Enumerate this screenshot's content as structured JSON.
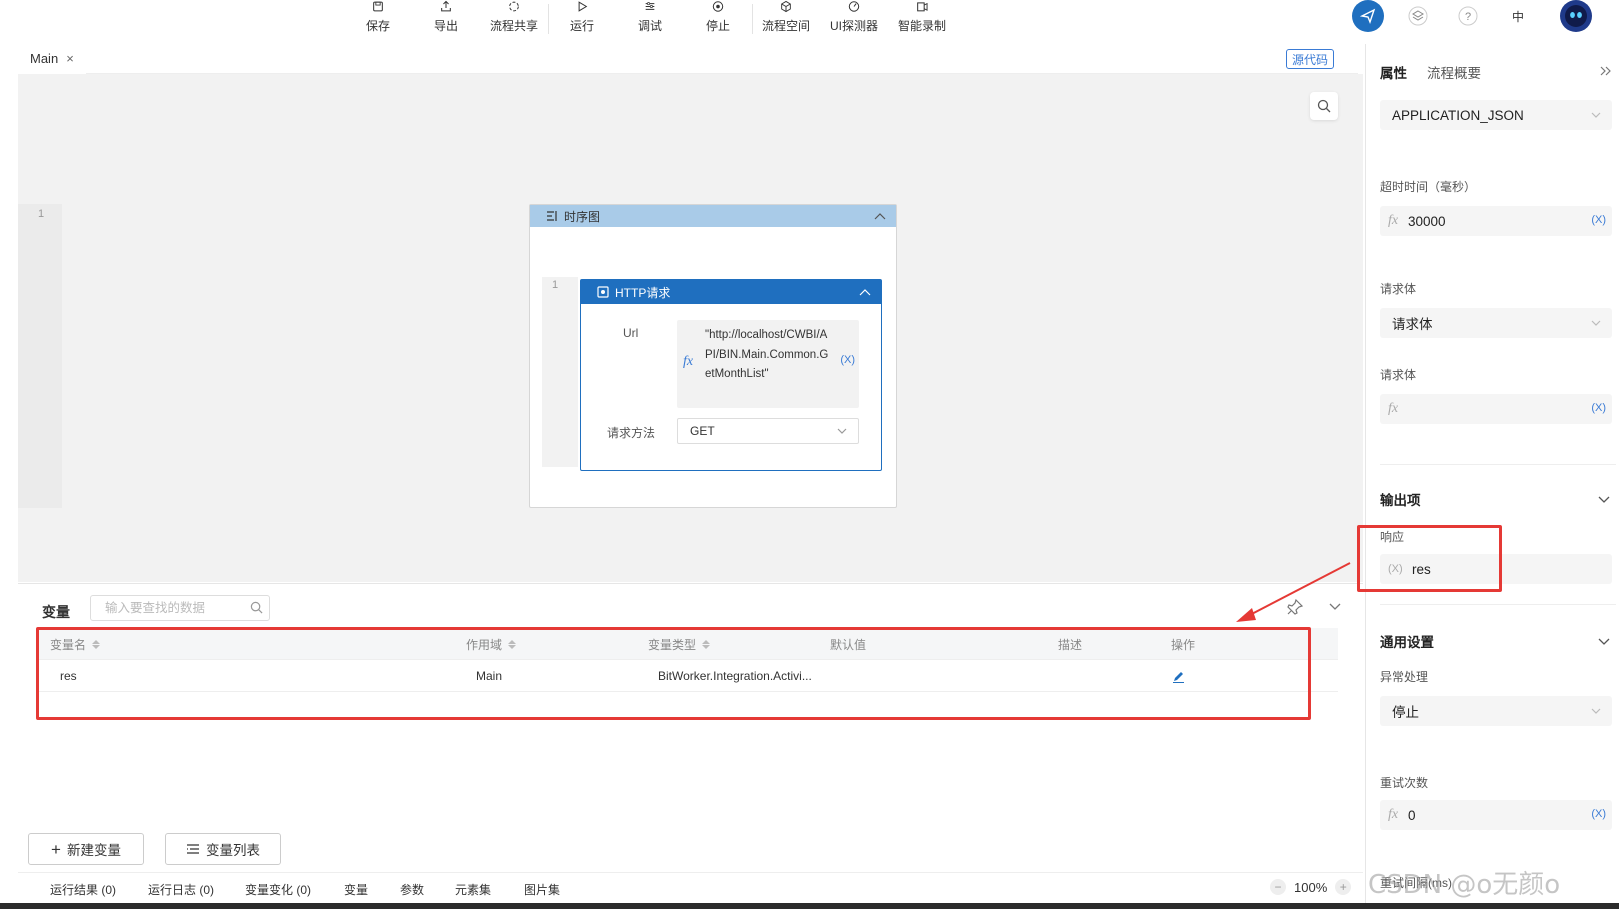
{
  "toolbar": {
    "items": [
      {
        "label": "保存",
        "icon": "save-icon"
      },
      {
        "label": "导出",
        "icon": "export-icon"
      },
      {
        "label": "流程共享",
        "icon": "share-icon"
      },
      {
        "label": "运行",
        "icon": "play-icon"
      },
      {
        "label": "调试",
        "icon": "debug-icon"
      },
      {
        "label": "停止",
        "icon": "stop-icon"
      },
      {
        "label": "流程空间",
        "icon": "cube-icon"
      },
      {
        "label": "UI探测器",
        "icon": "detector-icon"
      },
      {
        "label": "智能录制",
        "icon": "record-icon"
      }
    ],
    "right": {
      "lang": "中"
    }
  },
  "tab": {
    "label": "Main",
    "source_button": "源代码"
  },
  "canvas": {
    "gutter_line": "1",
    "sequence": {
      "title": "时序图",
      "line": "1",
      "http": {
        "title": "HTTP请求",
        "url_label": "Url",
        "url_value": "\"http://localhost/CWBI/API/BIN.Main.Common.GetMonthList\"",
        "method_label": "请求方法",
        "method_value": "GET",
        "var_marker": "(X)"
      }
    }
  },
  "variables": {
    "title": "变量",
    "search_placeholder": "输入要查找的数据",
    "columns": [
      "变量名",
      "作用域",
      "变量类型",
      "默认值",
      "描述",
      "操作"
    ],
    "rows": [
      {
        "name": "res",
        "scope": "Main",
        "type": "BitWorker.Integration.Activi...",
        "default": "",
        "desc": ""
      }
    ],
    "new_button": "新建变量",
    "list_button": "变量列表"
  },
  "statusbar": {
    "tabs": [
      "运行结果 (0)",
      "运行日志 (0)",
      "变量变化 (0)",
      "变量",
      "参数",
      "元素集",
      "图片集"
    ],
    "zoom": "100%",
    "zoom_minus": "−",
    "zoom_plus": "+"
  },
  "right_panel": {
    "tabs": {
      "properties": "属性",
      "overview": "流程概要"
    },
    "content_type": "APPLICATION_JSON",
    "timeout_label": "超时时间（毫秒）",
    "timeout_value": "30000",
    "body_type_label": "请求体",
    "body_type_value": "请求体",
    "body_label": "请求体",
    "body_value": "",
    "var_marker": "(X)",
    "output_section": "输出项",
    "response_label": "响应",
    "response_marker": "(X)",
    "response_value": "res",
    "general_section": "通用设置",
    "error_label": "异常处理",
    "error_value": "停止",
    "retry_label": "重试次数",
    "retry_value": "0",
    "retry_interval_label": "重试间隔(ms)"
  },
  "watermark": "CSDN @o无颜o",
  "colors": {
    "primary": "#1f6fbf",
    "sequence_header": "#a9cbe8",
    "highlight_red": "#e53935",
    "link_blue": "#3a7bd5"
  }
}
